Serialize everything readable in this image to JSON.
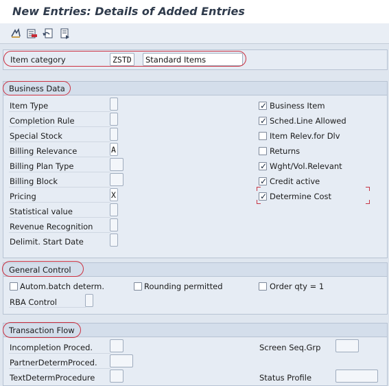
{
  "header": {
    "title": "New Entries: Details of Added Entries"
  },
  "toolbar": {
    "buttons": [
      {
        "icon": "change-display-icon"
      },
      {
        "icon": "delete-icon"
      },
      {
        "icon": "undo-icon"
      },
      {
        "icon": "copy-icon"
      }
    ]
  },
  "item_category": {
    "label": "Item category",
    "code": "ZSTD",
    "description": "Standard Items"
  },
  "business_data": {
    "title": "Business Data",
    "fields": [
      {
        "label": "Item Type",
        "value": ""
      },
      {
        "label": "Completion Rule",
        "value": ""
      },
      {
        "label": "Special Stock",
        "value": ""
      },
      {
        "label": "Billing Relevance",
        "value": "A"
      },
      {
        "label": "Billing Plan Type",
        "value": ""
      },
      {
        "label": "Billing Block",
        "value": ""
      },
      {
        "label": "Pricing",
        "value": "X"
      },
      {
        "label": "Statistical value",
        "value": ""
      },
      {
        "label": "Revenue Recognition",
        "value": ""
      },
      {
        "label": "Delimit. Start Date",
        "value": ""
      }
    ],
    "checkboxes": [
      {
        "label": "Business Item",
        "checked": true
      },
      {
        "label": "Sched.Line Allowed",
        "checked": true
      },
      {
        "label": "Item Relev.for Dlv",
        "checked": false
      },
      {
        "label": "Returns",
        "checked": false
      },
      {
        "label": "Wght/Vol.Relevant",
        "checked": true
      },
      {
        "label": "Credit active",
        "checked": true
      },
      {
        "label": "Determine Cost",
        "checked": true
      }
    ]
  },
  "general_control": {
    "title": "General Control",
    "checkboxes": [
      {
        "label": "Autom.batch determ.",
        "checked": false
      },
      {
        "label": "Rounding permitted",
        "checked": false
      },
      {
        "label": "Order qty = 1",
        "checked": false
      }
    ],
    "rba_label": "RBA Control",
    "rba_value": ""
  },
  "transaction_flow": {
    "title": "Transaction Flow",
    "left_fields": [
      {
        "label": "Incompletion Proced.",
        "value": ""
      },
      {
        "label": "PartnerDetermProced.",
        "value": ""
      },
      {
        "label": "TextDetermProcedure",
        "value": ""
      }
    ],
    "right_fields": [
      {
        "label": "Screen Seq.Grp",
        "value": ""
      },
      {
        "label": "Status Profile",
        "value": ""
      }
    ]
  },
  "colors": {
    "highlight_oval": "#cc3040",
    "background": "#dfe6ef"
  }
}
